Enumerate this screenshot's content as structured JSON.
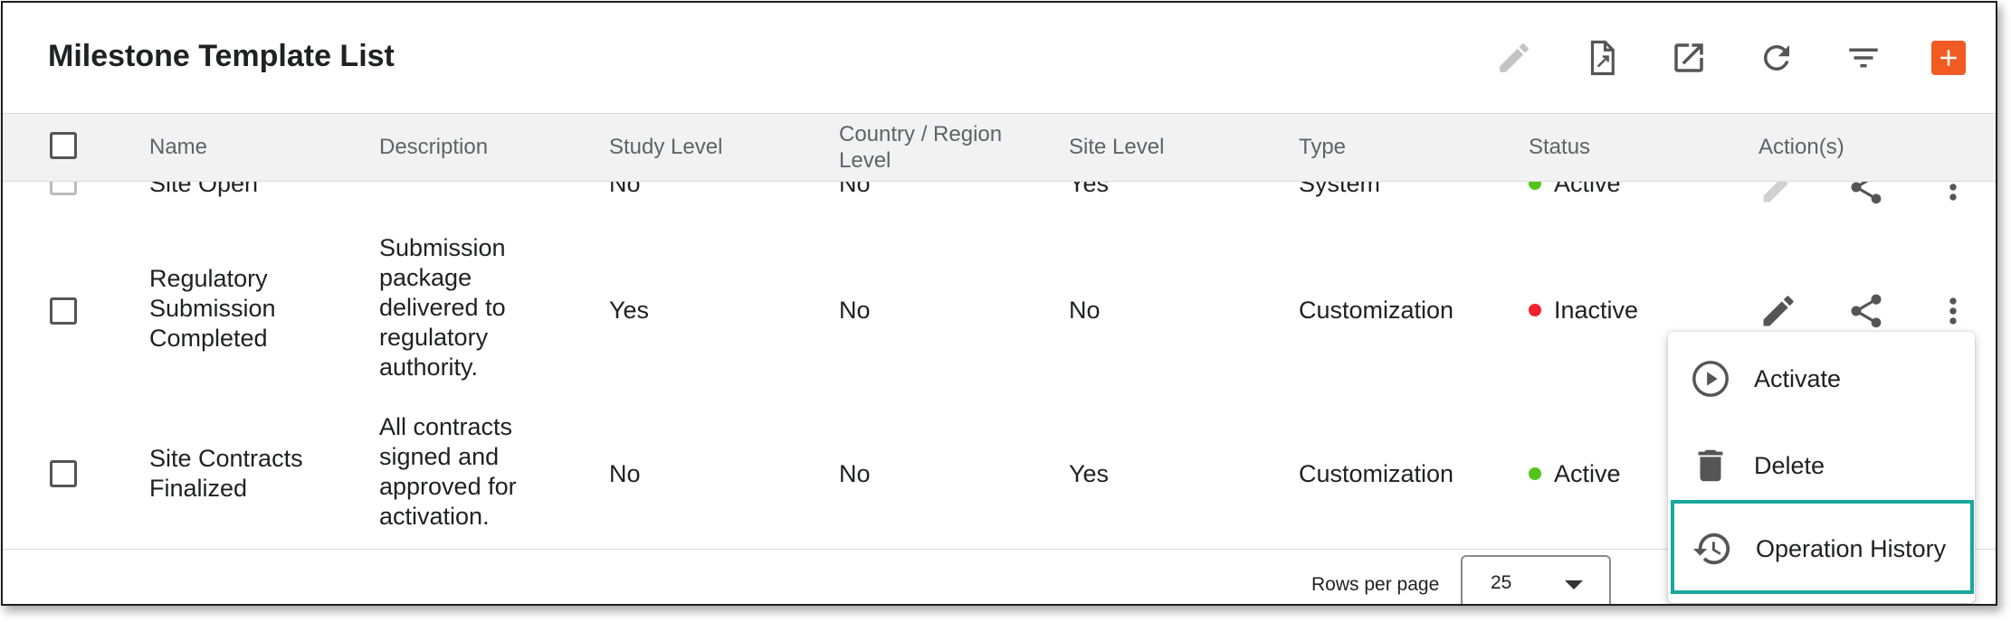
{
  "page": {
    "title": "Milestone Template List"
  },
  "toolbar": {
    "icons": [
      "pencil-icon",
      "export-file-icon",
      "open-external-icon",
      "refresh-icon",
      "filter-icon",
      "add-icon"
    ],
    "accent": "#f15a22"
  },
  "table": {
    "headers": {
      "name": "Name",
      "description": "Description",
      "study_level": "Study Level",
      "country_region_level_1": "Country / Region",
      "country_region_level_2": "Level",
      "site_level": "Site Level",
      "type": "Type",
      "status": "Status",
      "actions": "Action(s)"
    },
    "rows": [
      {
        "name": "Site Open",
        "description": "",
        "study_level": "No",
        "country_region_level": "No",
        "site_level": "Yes",
        "type": "System",
        "status": "Active"
      },
      {
        "name_lines": [
          "Regulatory",
          "Submission",
          "Completed"
        ],
        "description_lines": [
          "Submission",
          "package",
          "delivered to",
          "regulatory",
          "authority."
        ],
        "study_level": "Yes",
        "country_region_level": "No",
        "site_level": "No",
        "type": "Customization",
        "status": "Inactive"
      },
      {
        "name_lines": [
          "Site Contracts",
          "Finalized"
        ],
        "description_lines": [
          "All contracts",
          "signed and",
          "approved for",
          "activation."
        ],
        "study_level": "No",
        "country_region_level": "No",
        "site_level": "Yes",
        "type": "Customization",
        "status": "Active"
      }
    ],
    "status_colors": {
      "Active": "#52c41a",
      "Inactive": "#f5222d"
    }
  },
  "pagination": {
    "rows_per_page_label": "Rows per page",
    "rows_per_page_value": "25"
  },
  "context_menu": {
    "items": [
      {
        "label": "Activate",
        "icon": "play-circle-icon"
      },
      {
        "label": "Delete",
        "icon": "trash-icon"
      },
      {
        "label": "Operation History",
        "icon": "history-icon",
        "highlight_color": "#1aa79d"
      }
    ]
  }
}
